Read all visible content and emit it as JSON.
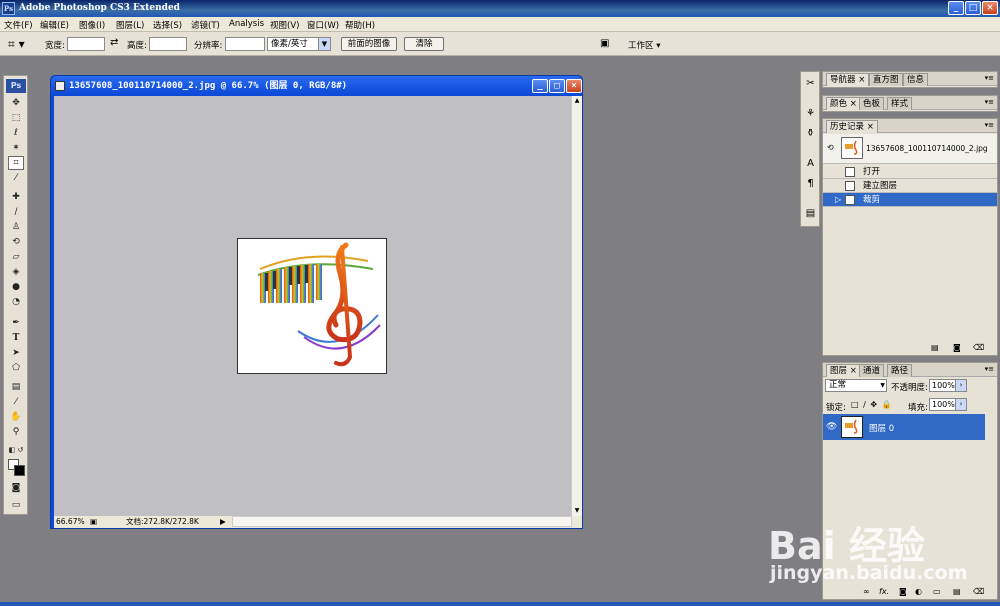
{
  "app": {
    "title": "Adobe Photoshop CS3 Extended",
    "icon_label": "Ps",
    "window_buttons": [
      "_",
      "□",
      "×"
    ]
  },
  "menu": [
    "文件(F)",
    "编辑(E)",
    "图像(I)",
    "图层(L)",
    "选择(S)",
    "滤镜(T)",
    "Analysis",
    "视图(V)",
    "窗口(W)",
    "帮助(H)"
  ],
  "options": {
    "width_label": "宽度:",
    "width_value": "",
    "swap_icon": "⇄",
    "height_label": "高度:",
    "height_value": "",
    "resolution_label": "分辨率:",
    "resolution_value": "",
    "unit": "像素/英寸",
    "front_image_button": "前面的图像",
    "clear_button": "清除",
    "workspace_label": "工作区 ▾"
  },
  "toolbox": {
    "logo": "Ps",
    "tools": [
      "move-tool",
      "marquee-tool",
      "lasso-tool",
      "magic-wand-tool",
      "crop-tool",
      "slice-tool",
      "healing-tool",
      "brush-tool",
      "clone-stamp-tool",
      "history-brush-tool",
      "eraser-tool",
      "paint-bucket-tool",
      "blur-tool",
      "dodge-tool",
      "pen-tool",
      "type-tool",
      "path-select-tool",
      "shape-tool",
      "notes-tool",
      "eyedropper-tool",
      "hand-tool",
      "zoom-tool"
    ],
    "active_tool": "crop-tool"
  },
  "document": {
    "title": "13657608_100110714000_2.jpg @ 66.7% (图层 0, RGB/8#)",
    "zoom": "66.67%",
    "doc_size": "文档:272.8K/272.8K"
  },
  "panels": {
    "navigator_tabs": [
      "导航器",
      "直方图",
      "信息"
    ],
    "color_tabs": [
      "颜色",
      "色板",
      "样式"
    ],
    "history": {
      "tab": "历史记录",
      "snapshot": "13657608_100110714000_2.jpg",
      "steps": [
        "打开",
        "建立图层",
        "裁剪"
      ],
      "selected_step": 2
    },
    "layers": {
      "tabs": [
        "图层",
        "通道",
        "路径"
      ],
      "blend_mode": "正常",
      "opacity_label": "不透明度:",
      "opacity": "100%",
      "lock_label": "锁定:",
      "fill_label": "填充:",
      "fill": "100%",
      "layer_name": "图层 0",
      "bottom_icons": [
        "link-icon",
        "fx-icon",
        "mask-icon",
        "adjustment-icon",
        "group-icon",
        "new-layer-icon",
        "trash-icon"
      ]
    }
  },
  "watermark": {
    "brand": "Bai 经验",
    "url": "jingyan.baidu.com"
  },
  "colors": {
    "titlebar": "#0a246a",
    "selection": "#3169c6",
    "workspace": "#7f7e82",
    "canvas_bg": "#c0bfc3"
  }
}
